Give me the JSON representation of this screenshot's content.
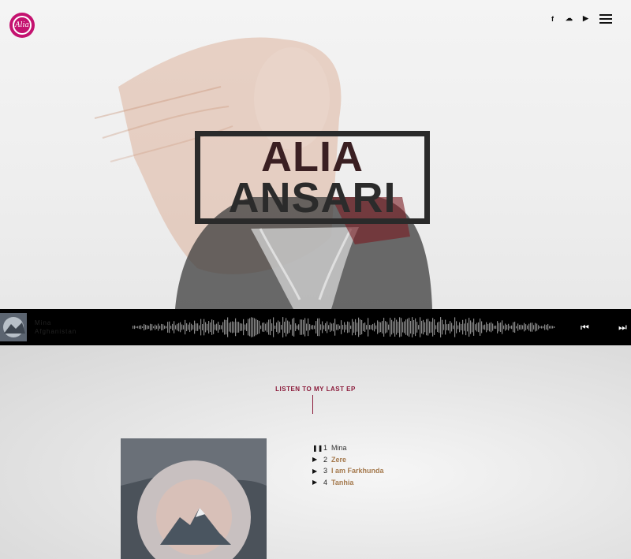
{
  "brand": {
    "logo_text": "Alia"
  },
  "header": {
    "social": [
      {
        "name": "facebook-icon",
        "glyph": "f"
      },
      {
        "name": "soundcloud-icon",
        "glyph": "☁"
      },
      {
        "name": "youtube-icon",
        "glyph": "▶"
      }
    ]
  },
  "hero": {
    "title_line1": "ALIA",
    "title_line2": "ANSARI"
  },
  "player": {
    "track_title": "Mina",
    "artist": "Afghanistan",
    "prev_glyph": "⏮",
    "next_glyph": "⏭"
  },
  "ep": {
    "heading": "LISTEN TO MY LAST EP",
    "tracks": [
      {
        "num": "1",
        "title": "Mina",
        "icon": "❚❚",
        "active": true
      },
      {
        "num": "2",
        "title": "Zere",
        "icon": "▶",
        "active": false
      },
      {
        "num": "3",
        "title": "I am Farkhunda",
        "icon": "▶",
        "active": false
      },
      {
        "num": "4",
        "title": "Tanhia",
        "icon": "▶",
        "active": false
      }
    ]
  },
  "colors": {
    "brand": "#c4126f",
    "accent": "#8b1a3a",
    "link": "#a57a4e"
  }
}
